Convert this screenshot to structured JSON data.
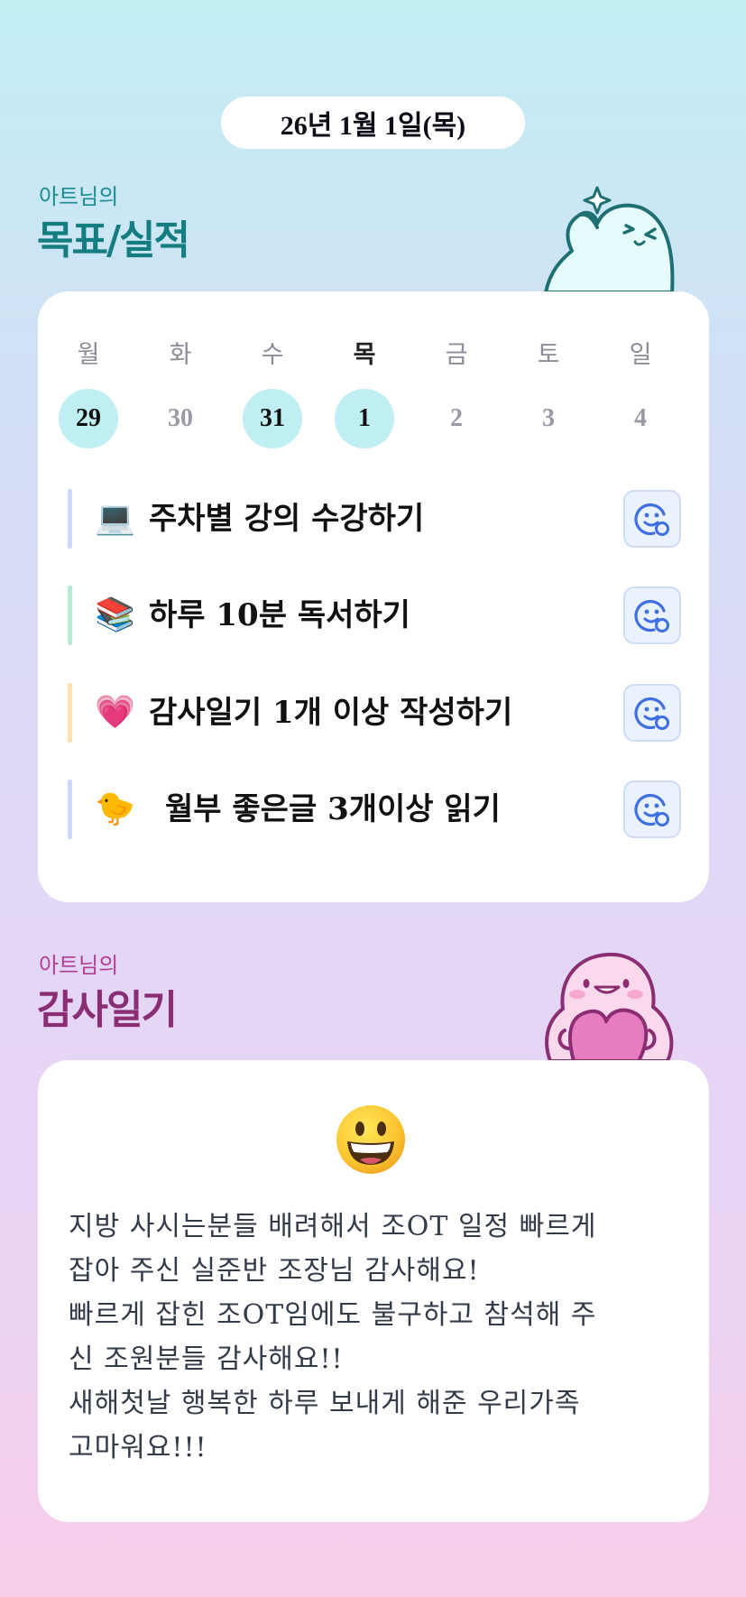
{
  "header": {
    "date": "26년 1월 1일(목)"
  },
  "goals_section": {
    "owner": "아트님의",
    "title": "목표/실적"
  },
  "week": {
    "days": [
      "월",
      "화",
      "수",
      "목",
      "금",
      "토",
      "일"
    ],
    "current_day_index": 3,
    "dates": [
      {
        "num": "29",
        "done": true
      },
      {
        "num": "30",
        "done": false
      },
      {
        "num": "31",
        "done": true
      },
      {
        "num": "1",
        "done": true
      },
      {
        "num": "2",
        "done": false
      },
      {
        "num": "3",
        "done": false
      },
      {
        "num": "4",
        "done": false
      }
    ]
  },
  "goals": [
    {
      "emoji": "💻",
      "label": "주차별 강의 수강하기",
      "bar_color": "#cdd9f8",
      "button_icon": "smile-add-icon"
    },
    {
      "emoji": "📚",
      "label": "하루 10분 독서하기",
      "bar_color": "#b8ebd6",
      "button_icon": "smile-add-icon"
    },
    {
      "emoji": "💗",
      "label": "감사일기 1개 이상 작성하기",
      "bar_color": "#fde3b4",
      "button_icon": "smile-add-icon"
    },
    {
      "emoji": "🐤",
      "label": "월부 좋은글 3개이상 읽기",
      "bar_color": "#cdd9f8",
      "button_icon": "smile-add-icon"
    }
  ],
  "gratitude_section": {
    "owner": "아트님의",
    "title": "감사일기"
  },
  "diary": {
    "mood_emoji": "grinning-face-icon",
    "lines": [
      "지방 사시는분들 배려해서 조OT 일정 빠르게",
      "잡아 주신 실준반 조장님 감사해요!",
      "빠르게 잡힌 조OT임에도 불구하고 참석해 주",
      "신 조원분들 감사해요!!",
      "새해첫날 행복한 하루 보내게 해준 우리가족",
      "고마워요!!!"
    ]
  },
  "colors": {
    "accent_teal": "#1a8c8f",
    "accent_magenta": "#b23f92",
    "done_circle": "#bfeef3",
    "button_blue": "#3f6fe0"
  }
}
